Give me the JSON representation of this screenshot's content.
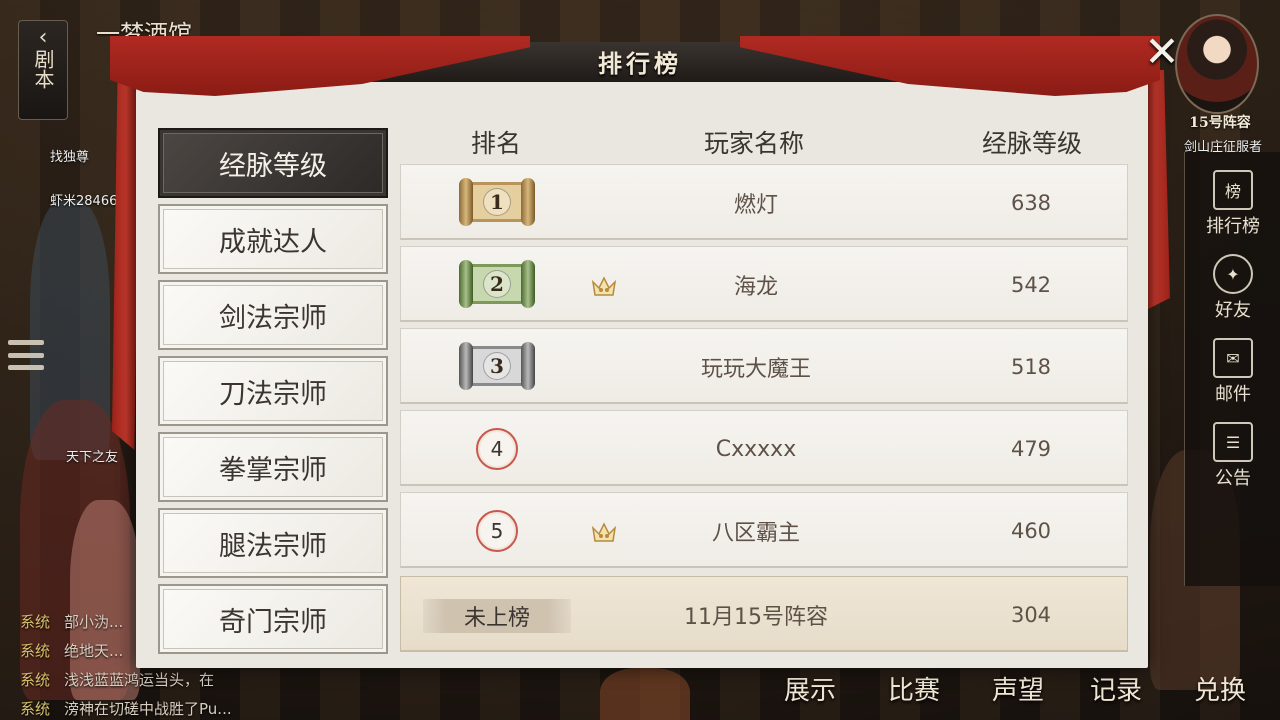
{
  "location": {
    "title": "一梦酒馆",
    "back_label": "剧本"
  },
  "avatar": {
    "label": "15号阵容"
  },
  "side_menu": [
    {
      "label": "排行榜",
      "icon": "ranking-board-icon"
    },
    {
      "label": "好友",
      "icon": "friends-icon"
    },
    {
      "label": "邮件",
      "icon": "mail-icon"
    },
    {
      "label": "公告",
      "icon": "announcement-icon"
    }
  ],
  "bottom_menu": [
    {
      "label": "展示"
    },
    {
      "label": "比赛"
    },
    {
      "label": "声望"
    },
    {
      "label": "记录"
    },
    {
      "label": "兑换"
    }
  ],
  "chat": [
    {
      "tag": "系统",
      "text": "部小沩..."
    },
    {
      "tag": "系统",
      "text": "绝地天..."
    },
    {
      "tag": "系统",
      "text": "浅浅蓝蓝鸿运当头，在"
    },
    {
      "tag": "系统",
      "text": "滂神在切磋中战胜了Pu..."
    }
  ],
  "npc_labels": [
    {
      "text": "找独尊"
    },
    {
      "text": "虾米28466"
    },
    {
      "text": "天下之友"
    },
    {
      "text": "剑山庄征服者"
    }
  ],
  "panel": {
    "title": "排行榜",
    "close_icon": "close-icon"
  },
  "tabs": [
    {
      "label": "经脉等级",
      "active": true
    },
    {
      "label": "成就达人",
      "active": false
    },
    {
      "label": "剑法宗师",
      "active": false
    },
    {
      "label": "刀法宗师",
      "active": false
    },
    {
      "label": "拳掌宗师",
      "active": false
    },
    {
      "label": "腿法宗师",
      "active": false
    },
    {
      "label": "奇门宗师",
      "active": false
    }
  ],
  "table": {
    "headers": {
      "rank": "排名",
      "name": "玩家名称",
      "score": "经脉等级"
    },
    "rows": [
      {
        "rank": "1",
        "name": "燃灯",
        "score": "638",
        "badge": "gold-scroll",
        "crown": false
      },
      {
        "rank": "2",
        "name": "海龙",
        "score": "542",
        "badge": "green-scroll",
        "crown": true
      },
      {
        "rank": "3",
        "name": "玩玩大魔王",
        "score": "518",
        "badge": "silver-scroll",
        "crown": false
      },
      {
        "rank": "4",
        "name": "Cxxxxx",
        "score": "479",
        "badge": "circle",
        "crown": false
      },
      {
        "rank": "5",
        "name": "八区霸主",
        "score": "460",
        "badge": "circle",
        "crown": true
      }
    ],
    "mine": {
      "rank_label": "未上榜",
      "name": "11月15号阵容",
      "score": "304"
    }
  },
  "colors": {
    "gold_scroll": "#d8b77a",
    "green_scroll": "#a8c08a",
    "silver_scroll": "#b9b9b9",
    "curtain_red": "#b02a22",
    "rank_circle": "#c9574d"
  }
}
